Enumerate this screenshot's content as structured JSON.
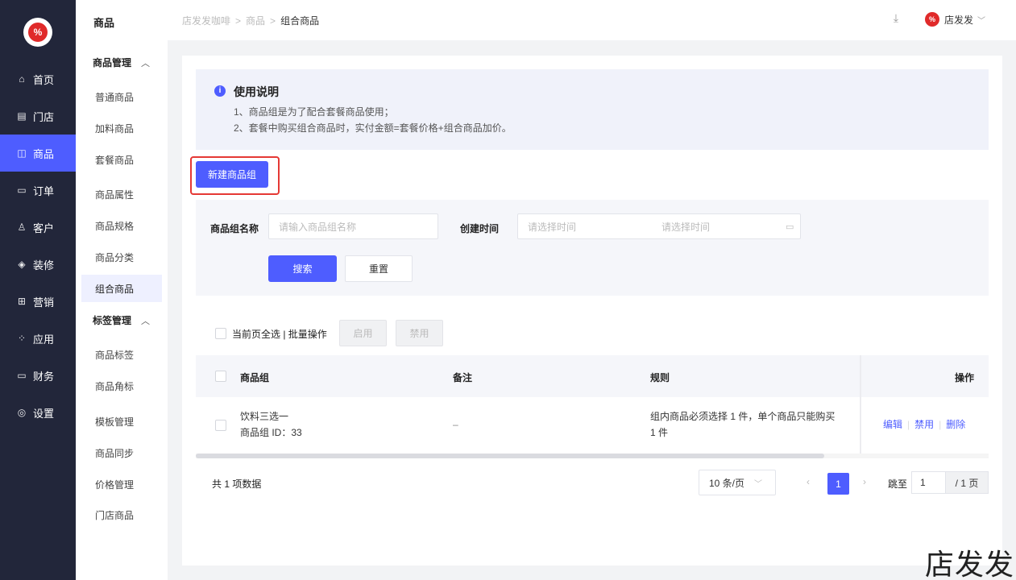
{
  "nav": {
    "logo": "%",
    "items": [
      {
        "label": "首页",
        "icon": "⌂"
      },
      {
        "label": "门店",
        "icon": "▤"
      },
      {
        "label": "商品",
        "icon": "◫"
      },
      {
        "label": "订单",
        "icon": "▭"
      },
      {
        "label": "客户",
        "icon": "♙"
      },
      {
        "label": "装修",
        "icon": "◈"
      },
      {
        "label": "营销",
        "icon": "⊞"
      },
      {
        "label": "应用",
        "icon": "⁘"
      },
      {
        "label": "财务",
        "icon": "▭"
      },
      {
        "label": "设置",
        "icon": "◎"
      }
    ]
  },
  "submenu": {
    "title": "商品",
    "group1": "商品管理",
    "group1_items": [
      "普通商品",
      "加料商品",
      "套餐商品"
    ],
    "items_mid": [
      "商品属性",
      "商品规格",
      "商品分类",
      "组合商品"
    ],
    "group2": "标签管理",
    "group2_items": [
      "商品标签",
      "商品角标"
    ],
    "items_bottom": [
      "模板管理",
      "商品同步",
      "价格管理",
      "门店商品"
    ]
  },
  "breadcrumb": [
    "店发发咖啡",
    "商品",
    "组合商品"
  ],
  "user": {
    "name": "店发发",
    "logo": "%"
  },
  "notice": {
    "title": "使用说明",
    "line1": "1、商品组是为了配合套餐商品使用；",
    "line2": "2、套餐中购买组合商品时，实付金额=套餐价格+组合商品加价。"
  },
  "new_button": "新建商品组",
  "filter": {
    "name_label": "商品组名称",
    "name_placeholder": "请输入商品组名称",
    "time_label": "创建时间",
    "time_start_placeholder": "请选择时间",
    "time_end_placeholder": "请选择时间",
    "search_button": "搜索",
    "reset_button": "重置"
  },
  "bulk": {
    "label": "当前页全选 | 批量操作",
    "enable": "启用",
    "disable": "禁用"
  },
  "table": {
    "headers": {
      "group": "商品组",
      "remark": "备注",
      "rule": "规则",
      "action": "操作"
    },
    "rows": [
      {
        "name": "饮料三选一",
        "id_text": "商品组 ID：33",
        "remark": "–",
        "rule_line1": "组内商品必须选择 1 件，单个商品只能购买",
        "rule_line2": "1 件",
        "actions": [
          "编辑",
          "禁用",
          "删除"
        ]
      }
    ]
  },
  "pagination": {
    "total": "共 1 项数据",
    "page_size": "10 条/页",
    "current_page": "1",
    "jump_label": "跳至",
    "jump_value": "1",
    "total_pages": "/ 1 页"
  },
  "watermark": "店发发",
  "colors": {
    "primary": "#4e5dff",
    "sidebar": "#22263a",
    "highlight": "#e53935"
  }
}
